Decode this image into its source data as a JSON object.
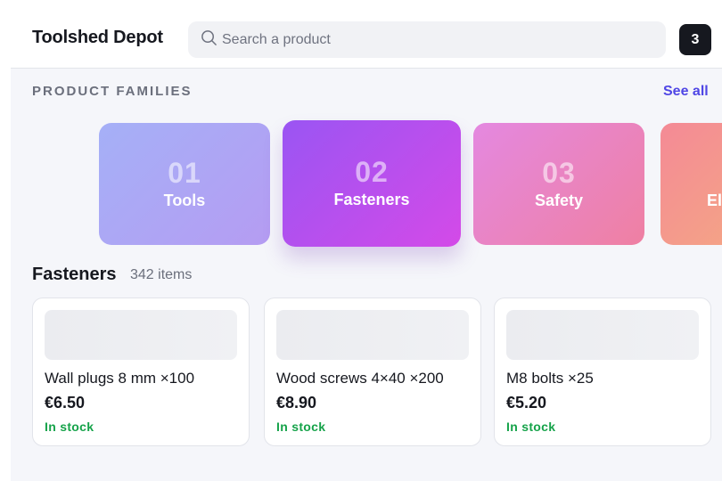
{
  "header": {
    "brand": "Toolshed Depot",
    "search_placeholder": "Search a product",
    "search_icon": "search-icon",
    "cart_count": "3"
  },
  "families": {
    "label": "PRODUCT FAMILIES",
    "see_all": "See all",
    "items": [
      {
        "number": "01",
        "name": "Tools"
      },
      {
        "number": "02",
        "name": "Fasteners",
        "selected": true
      },
      {
        "number": "03",
        "name": "Safety"
      },
      {
        "number": "",
        "name": "El"
      }
    ]
  },
  "section": {
    "title": "Fasteners",
    "count": "342 items"
  },
  "products": [
    {
      "title": "Wall plugs 8 mm ×100",
      "price": "€6.50",
      "stock": "In stock"
    },
    {
      "title": "Wood screws 4×40 ×200",
      "price": "€8.90",
      "stock": "In stock"
    },
    {
      "title": "M8 bolts ×25",
      "price": "€5.20",
      "stock": "In stock"
    }
  ],
  "colors": {
    "accent": "#4f46e5",
    "in_stock": "#16a34a",
    "dark": "#16181f"
  }
}
